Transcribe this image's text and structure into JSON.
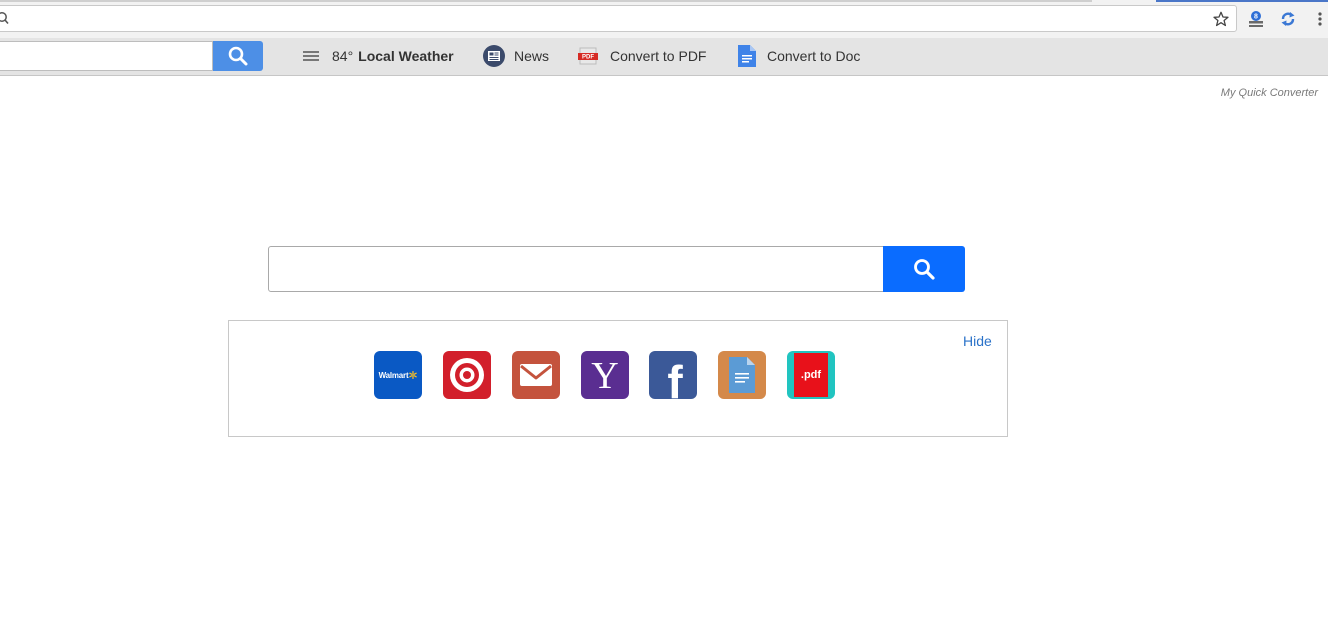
{
  "browser": {
    "address_value": "",
    "accent": "#4a76c8"
  },
  "toolbar": {
    "search_value": "",
    "weather_temp": "84°",
    "weather_label": "Local Weather",
    "news_label": "News",
    "pdf_label": "Convert to PDF",
    "doc_label": "Convert to Doc",
    "search_button_color": "#4d8fe6"
  },
  "brand": {
    "name": "My Quick Converter"
  },
  "main": {
    "search_value": "",
    "search_button_color": "#0a6cff"
  },
  "shortcuts": {
    "hide_label": "Hide",
    "items": [
      {
        "name": "walmart",
        "icon": "walmart-icon",
        "text": "Walmart",
        "color": "#0a59c4"
      },
      {
        "name": "target",
        "icon": "target-icon",
        "color": "#d21f2b"
      },
      {
        "name": "gmail",
        "icon": "mail-icon",
        "color": "#c4533d"
      },
      {
        "name": "yahoo",
        "icon": "yahoo-icon",
        "text": "Y",
        "color": "#5a2e91"
      },
      {
        "name": "facebook",
        "icon": "facebook-icon",
        "text": "f",
        "color": "#3b5998"
      },
      {
        "name": "docs",
        "icon": "document-icon",
        "color": "#d4894a"
      },
      {
        "name": "pdf",
        "icon": "pdf-icon",
        "text": ".pdf",
        "color": "#21c4c0"
      }
    ]
  }
}
